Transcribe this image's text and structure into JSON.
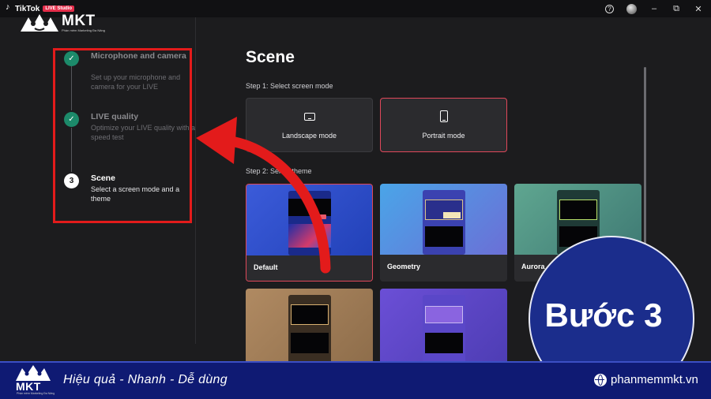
{
  "titlebar": {
    "app_name": "TikTok",
    "badge": "LIVE Studio",
    "help_icon": "?",
    "minimize": "–",
    "maximize": "⧉",
    "close": "✕"
  },
  "watermark": {
    "brand": "MKT",
    "slogan": "Phần mềm Marketing Đa Năng"
  },
  "steps": [
    {
      "number": "✓",
      "title": "Microphone and camera",
      "desc": "Set up your microphone and camera for your LIVE",
      "state": "done"
    },
    {
      "number": "✓",
      "title": "LIVE quality",
      "desc": "Optimize your LIVE quality with a speed test",
      "state": "done"
    },
    {
      "number": "3",
      "title": "Scene",
      "desc": "Select a screen mode and a theme",
      "state": "current"
    }
  ],
  "main": {
    "title": "Scene",
    "step1_label": "Step 1: Select screen mode",
    "step2_label": "Step 2: Select theme",
    "modes": [
      {
        "label": "Landscape mode",
        "icon": "landscape-icon",
        "selected": false
      },
      {
        "label": "Portrait mode",
        "icon": "portrait-icon",
        "selected": true
      }
    ],
    "themes": [
      {
        "name": "Default",
        "selected": true
      },
      {
        "name": "Geometry",
        "selected": false
      },
      {
        "name": "Aurora",
        "selected": false
      },
      {
        "name": "",
        "selected": false
      },
      {
        "name": "",
        "selected": false
      }
    ]
  },
  "overlay": {
    "badge_text": "Bước 3",
    "accent_color": "#e31b1b",
    "badge_color": "#1b2d8c"
  },
  "banner": {
    "brand": "MKT",
    "slogan": "Phần mềm Marketing Đa Năng",
    "tagline": "Hiệu quả - Nhanh  - Dễ dùng",
    "website": "phanmemmkt.vn"
  }
}
